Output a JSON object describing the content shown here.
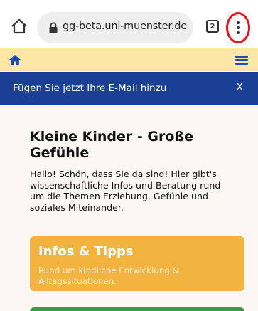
{
  "browser": {
    "url": "gg-beta.uni-muenster.de",
    "tab_count": "2",
    "highlight_color": "#e8131a"
  },
  "site": {
    "navbar_color": "#fde7a6",
    "icon_color": "#1a4fae"
  },
  "banner": {
    "text": "Fügen Sie jetzt Ihre E-Mail hinzu",
    "close_label": "X",
    "color": "#1a3f95"
  },
  "page": {
    "title": "Kleine Kinder - Große Gefühle",
    "intro": "Hallo! Schön, dass Sie da sind! Hier gibt's wissenschaftliche Infos und Beratung rund um die Themen Erziehung, Gefühle und soziales Miteinander."
  },
  "cards": [
    {
      "title": "Infos & Tipps",
      "subtitle": "Rund um kindliche Entwicklung & Alltagssituationen.",
      "color": "#f2b33f"
    },
    {
      "color": "#3f9a46"
    }
  ]
}
